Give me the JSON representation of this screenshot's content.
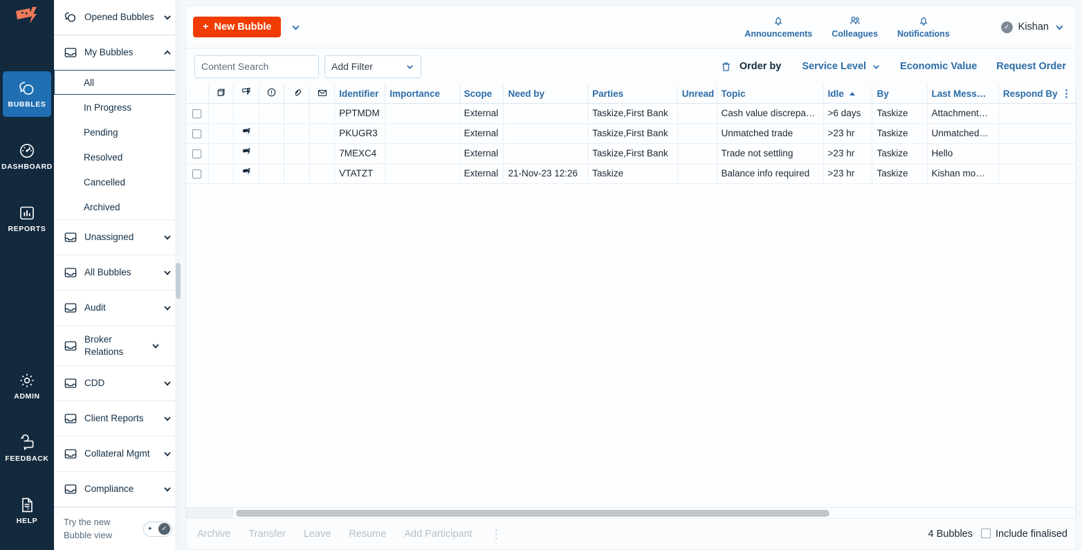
{
  "brand": {
    "logo_icon": "taskize-flag-bolt-logo",
    "accent_orange": "#f03c02",
    "accent_blue": "#2c6ca8",
    "rail_navy": "#13293d",
    "active_tile": "#1f6fb2"
  },
  "rail": {
    "items": [
      {
        "label": "BUBBLES",
        "icon": "bubbles-icon",
        "active": true
      },
      {
        "label": "DASHBOARD",
        "icon": "dashboard-gauge-icon",
        "active": false
      },
      {
        "label": "REPORTS",
        "icon": "reports-bar-chart-icon",
        "active": false
      },
      {
        "label": "ADMIN",
        "icon": "gear-icon",
        "active": false
      },
      {
        "label": "FEEDBACK",
        "icon": "feedback-chat-refresh-icon",
        "active": false
      },
      {
        "label": "HELP",
        "icon": "help-document-question-icon",
        "active": false
      }
    ]
  },
  "sidebar": {
    "top": {
      "label": "Opened Bubbles",
      "icon": "bubbles-icon",
      "chevron": "chevron-down-icon"
    },
    "groups": [
      {
        "label": "My Bubbles",
        "icon": "inbox-icon",
        "chevron": "chevron-up-icon",
        "expanded": true,
        "children": [
          {
            "label": "All",
            "selected": true
          },
          {
            "label": "In Progress",
            "selected": false
          },
          {
            "label": "Pending",
            "selected": false
          },
          {
            "label": "Resolved",
            "selected": false
          },
          {
            "label": "Cancelled",
            "selected": false
          },
          {
            "label": "Archived",
            "selected": false
          }
        ]
      },
      {
        "label": "Unassigned",
        "icon": "inbox-icon",
        "chevron": "chevron-down-icon",
        "expanded": false,
        "children": []
      },
      {
        "label": "All Bubbles",
        "icon": "inbox-icon",
        "chevron": "chevron-down-icon",
        "expanded": false,
        "children": []
      },
      {
        "label": "Audit",
        "icon": "inbox-icon",
        "chevron": "chevron-down-icon",
        "expanded": false,
        "children": []
      },
      {
        "label": "Broker Relations",
        "icon": "inbox-icon",
        "chevron": "chevron-down-icon",
        "expanded": false,
        "children": []
      },
      {
        "label": "CDD",
        "icon": "inbox-icon",
        "chevron": "chevron-down-icon",
        "expanded": false,
        "children": []
      },
      {
        "label": "Client Reports",
        "icon": "inbox-icon",
        "chevron": "chevron-down-icon",
        "expanded": false,
        "children": []
      },
      {
        "label": "Collateral Mgmt",
        "icon": "inbox-icon",
        "chevron": "chevron-down-icon",
        "expanded": false,
        "children": []
      },
      {
        "label": "Compliance",
        "icon": "inbox-icon",
        "chevron": "chevron-down-icon",
        "expanded": false,
        "children": []
      }
    ],
    "footer": {
      "text_line1": "Try the new",
      "text_line2": "Bubble view",
      "toggle_state": "on",
      "toggle_spark": "✦",
      "toggle_check": "✓"
    }
  },
  "toolbar": {
    "new_bubble_label": "New Bubble",
    "new_bubble_plus": "+",
    "new_bubble_caret": "chevron-down-icon",
    "actions": [
      {
        "label": "Announcements",
        "icon": "bell-icon"
      },
      {
        "label": "Colleagues",
        "icon": "people-icon"
      },
      {
        "label": "Notifications",
        "icon": "bell-icon"
      }
    ],
    "user": {
      "name": "Kishan",
      "avatar_icon": "verified-check-avatar",
      "caret": "chevron-down-icon"
    }
  },
  "filters": {
    "content_search_value": "",
    "content_search_placeholder": "Content Search",
    "add_filter_label": "Add Filter",
    "add_filter_caret": "chevron-down-icon",
    "trash_icon": "trash-icon",
    "order_by_label": "Order by",
    "order_options": [
      {
        "label": "Service Level",
        "caret": "chevron-down-icon"
      },
      {
        "label": "Economic Value",
        "caret": ""
      },
      {
        "label": "Request Order",
        "caret": ""
      }
    ]
  },
  "table": {
    "icon_columns": [
      {
        "icon": "archive-box-icon",
        "name": "column-archive"
      },
      {
        "icon": "flag-icon",
        "name": "column-flag"
      },
      {
        "icon": "alert-circle-icon",
        "name": "column-alert"
      },
      {
        "icon": "attachment-link-icon",
        "name": "column-attachment"
      },
      {
        "icon": "envelope-icon",
        "name": "column-mail"
      }
    ],
    "columns": [
      {
        "label": "Identifier",
        "key": "identifier"
      },
      {
        "label": "Importance",
        "key": "importance"
      },
      {
        "label": "Scope",
        "key": "scope"
      },
      {
        "label": "Need by",
        "key": "need_by"
      },
      {
        "label": "Parties",
        "key": "parties"
      },
      {
        "label": "Unread",
        "key": "unread"
      },
      {
        "label": "Topic",
        "key": "topic"
      },
      {
        "label": "Idle",
        "key": "idle",
        "sorted": "asc"
      },
      {
        "label": "By",
        "key": "by"
      },
      {
        "label": "Last Mess…",
        "key": "last_message"
      },
      {
        "label": "Respond By",
        "key": "respond_by"
      }
    ],
    "kebab_icon": "more-vertical-icon",
    "rows": [
      {
        "checked": false,
        "flag": false,
        "identifier": "PPTMDM",
        "importance": "",
        "scope": "External",
        "need_by": "",
        "parties": "Taskize,First Bank",
        "unread": "",
        "topic": "Cash value discrepancy",
        "idle": ">6 days",
        "by": "Taskize",
        "last_message": "Attachment…",
        "respond_by": ""
      },
      {
        "checked": false,
        "flag": true,
        "identifier": "PKUGR3",
        "importance": "",
        "scope": "External",
        "need_by": "",
        "parties": "Taskize,First Bank",
        "unread": "",
        "topic": "Unmatched trade",
        "idle": ">23 hr",
        "by": "Taskize",
        "last_message": "Unmatched…",
        "respond_by": ""
      },
      {
        "checked": false,
        "flag": true,
        "identifier": "7MEXC4",
        "importance": "",
        "scope": "External",
        "need_by": "",
        "parties": "Taskize,First Bank",
        "unread": "",
        "topic": "Trade not settling",
        "idle": ">23 hr",
        "by": "Taskize",
        "last_message": "Hello",
        "respond_by": ""
      },
      {
        "checked": false,
        "flag": true,
        "identifier": "VTATZT",
        "importance": "",
        "scope": "External",
        "need_by": "21-Nov-23 12:26",
        "parties": "Taskize",
        "unread": "",
        "topic": "Balance info required",
        "idle": ">23 hr",
        "by": "Taskize",
        "last_message": "Kishan mo…",
        "respond_by": ""
      }
    ]
  },
  "bottom": {
    "actions": [
      "Archive",
      "Transfer",
      "Leave",
      "Resume",
      "Add Participant"
    ],
    "kebab_icon": "more-vertical-icon",
    "count_label": "4 Bubbles",
    "include_finalised_label": "Include finalised",
    "include_finalised_checked": false
  }
}
